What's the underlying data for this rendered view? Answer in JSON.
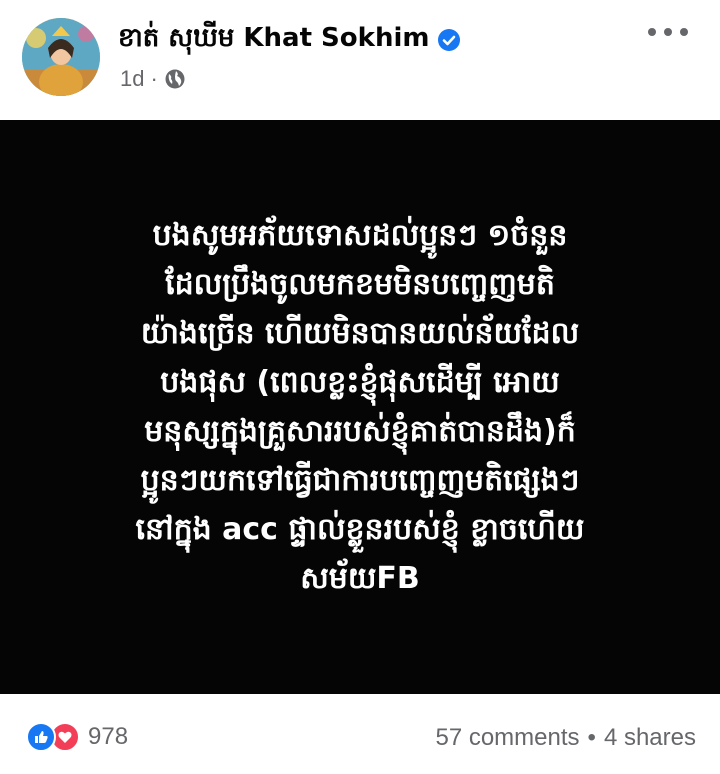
{
  "post": {
    "author": {
      "name": "ខាត់ សុឃីម Khat Sokhim",
      "verified": true,
      "avatar_icon": "avatar-photo"
    },
    "timestamp": "1d",
    "separator": "·",
    "audience_icon": "globe-icon",
    "more_icon": "more-options-icon",
    "image_text": "បងសូមអភ័យទោសដល់ប្អូនៗ ១ចំនួន\nដែលប្រឹងចូលមកខមមិនបញ្ចេញមតិ\nយ៉ាងច្រើន ហើយមិនបានយល់ន័យដែល\nបងផុស (ពេលខ្លះខ្ញុំផុសដើម្បី អោយ\nមនុស្សក្នុងគ្រួសាររបស់ខ្ញុំគាត់បានដឹង)ក៏\nប្អូនៗយកទៅធ្វើជាការបញ្ចេញមតិផ្សេងៗ\nនៅក្នុង acc ផ្ទាល់ខ្លួនរបស់ខ្ញុំ ខ្លាចហើយ\nសម័យFB",
    "image_background": "#050505",
    "image_text_color": "#ffffff"
  },
  "footer": {
    "reaction_icons": [
      "like-icon",
      "love-icon"
    ],
    "reaction_count": "978",
    "comments": "57 comments",
    "stats_separator": "•",
    "shares": "4 shares"
  },
  "colors": {
    "like_blue": "#1877f2",
    "love_red": "#f33e58",
    "secondary_text": "#65676b",
    "verified_blue": "#1877f2"
  }
}
